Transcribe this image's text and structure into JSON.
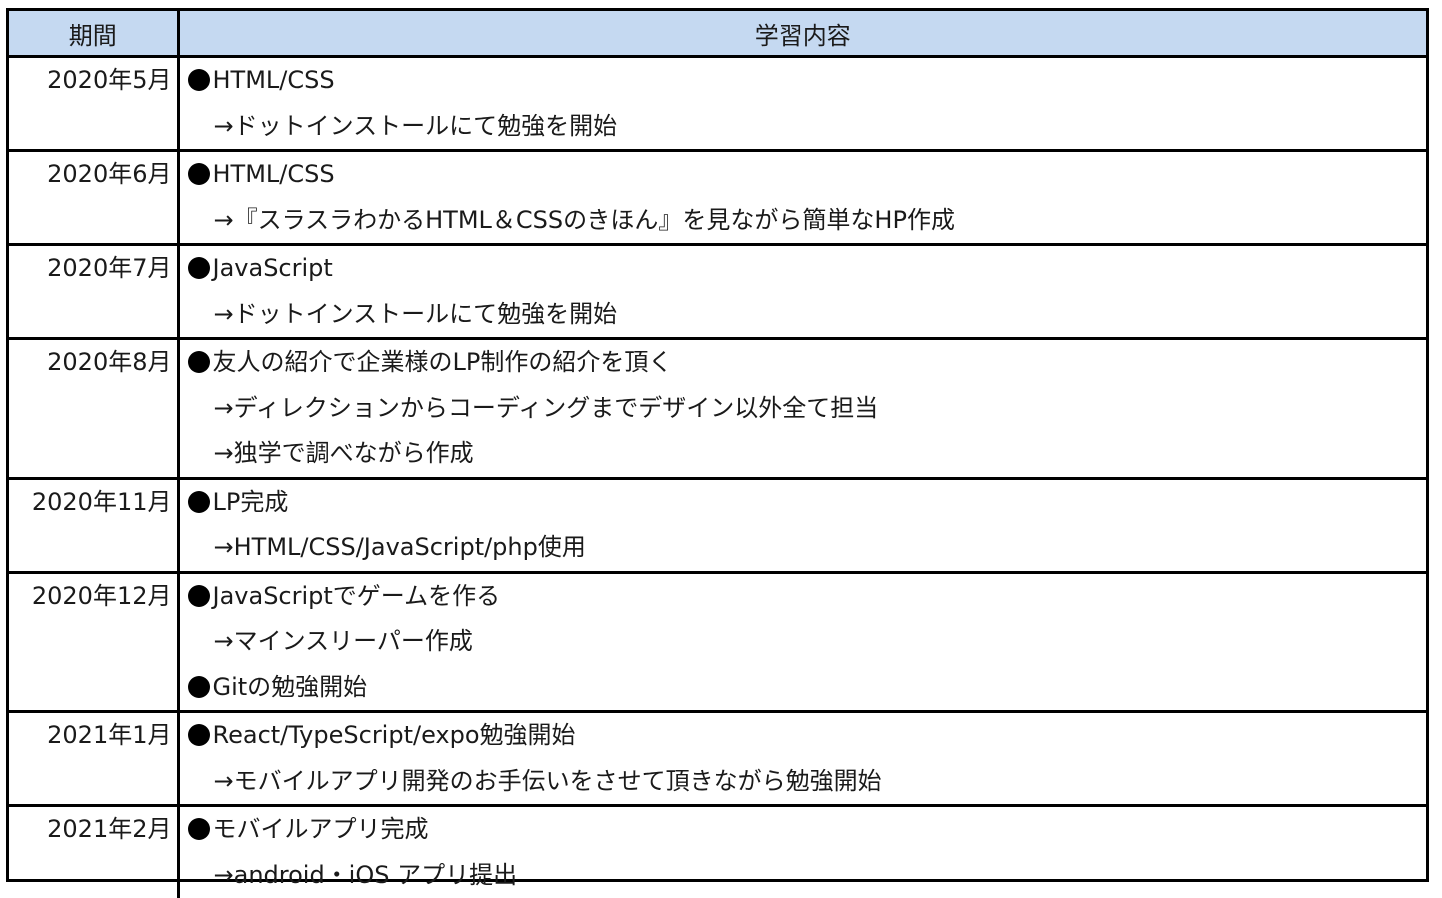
{
  "headers": {
    "period": "期間",
    "content": "学習内容"
  },
  "rows": [
    {
      "period": "2020年5月",
      "lines": [
        {
          "kind": "item",
          "text": "HTML/CSS"
        },
        {
          "kind": "sub",
          "text": "→ドットインストールにて勉強を開始"
        }
      ]
    },
    {
      "period": "2020年6月",
      "lines": [
        {
          "kind": "item",
          "text": "HTML/CSS"
        },
        {
          "kind": "sub",
          "text": "→『スラスラわかるHTML＆CSSのきほん』を見ながら簡単なHP作成"
        }
      ]
    },
    {
      "period": "2020年7月",
      "lines": [
        {
          "kind": "item",
          "text": "JavaScript"
        },
        {
          "kind": "sub",
          "text": "→ドットインストールにて勉強を開始"
        }
      ]
    },
    {
      "period": "2020年8月",
      "lines": [
        {
          "kind": "item",
          "text": "友人の紹介で企業様のLP制作の紹介を頂く"
        },
        {
          "kind": "sub",
          "text": "→ディレクションからコーディングまでデザイン以外全て担当"
        },
        {
          "kind": "sub",
          "text": "→独学で調べながら作成"
        }
      ]
    },
    {
      "period": "2020年11月",
      "lines": [
        {
          "kind": "item",
          "text": "LP完成"
        },
        {
          "kind": "sub",
          "text": "→HTML/CSS/JavaScript/php使用"
        }
      ]
    },
    {
      "period": "2020年12月",
      "lines": [
        {
          "kind": "item",
          "text": "JavaScriptでゲームを作る"
        },
        {
          "kind": "sub",
          "text": "→マインスリーパー作成"
        },
        {
          "kind": "item",
          "text": "Gitの勉強開始"
        }
      ]
    },
    {
      "period": "2021年1月",
      "lines": [
        {
          "kind": "item",
          "text": "React/TypeScript/expo勉強開始"
        },
        {
          "kind": "sub",
          "text": "→モバイルアプリ開発のお手伝いをさせて頂きながら勉強開始"
        }
      ]
    },
    {
      "period": "2021年2月",
      "lines": [
        {
          "kind": "item",
          "text": "モバイルアプリ完成"
        },
        {
          "kind": "sub",
          "text": "→android・iOS アプリ提出"
        }
      ]
    }
  ]
}
